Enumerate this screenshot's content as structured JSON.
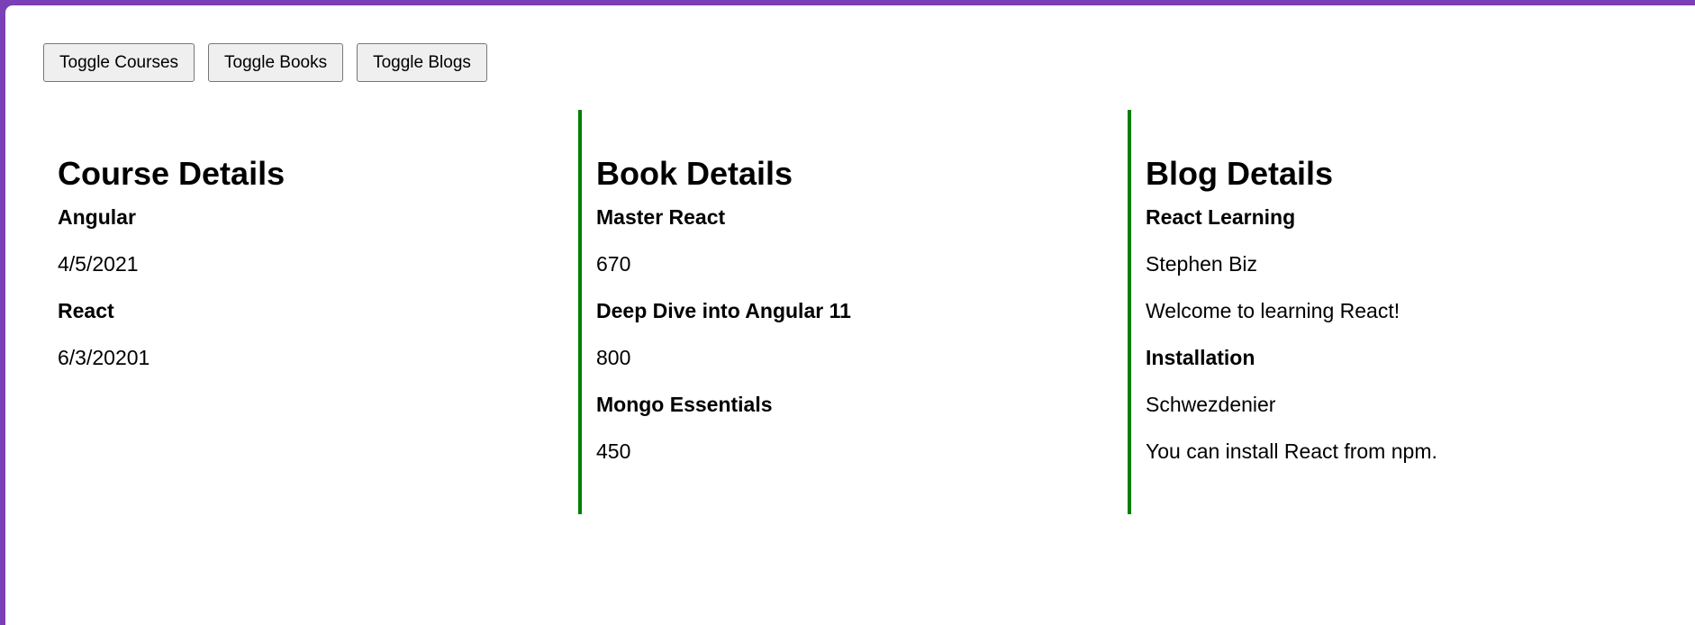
{
  "toolbar": {
    "toggle_courses": "Toggle Courses",
    "toggle_books": "Toggle Books",
    "toggle_blogs": "Toggle Blogs"
  },
  "courses": {
    "heading": "Course Details",
    "items": [
      {
        "name": "Angular",
        "date": "4/5/2021"
      },
      {
        "name": "React",
        "date": "6/3/20201"
      }
    ]
  },
  "books": {
    "heading": "Book Details",
    "items": [
      {
        "name": "Master React",
        "price": "670"
      },
      {
        "name": "Deep Dive into Angular 11",
        "price": "800"
      },
      {
        "name": "Mongo Essentials",
        "price": "450"
      }
    ]
  },
  "blogs": {
    "heading": "Blog Details",
    "items": [
      {
        "title": "React Learning",
        "author": "Stephen Biz",
        "content": "Welcome to learning React!"
      },
      {
        "title": "Installation",
        "author": "Schwezdenier",
        "content": "You can install React from npm."
      }
    ]
  },
  "colors": {
    "window_border": "#7b3fb8",
    "divider": "#008000"
  }
}
